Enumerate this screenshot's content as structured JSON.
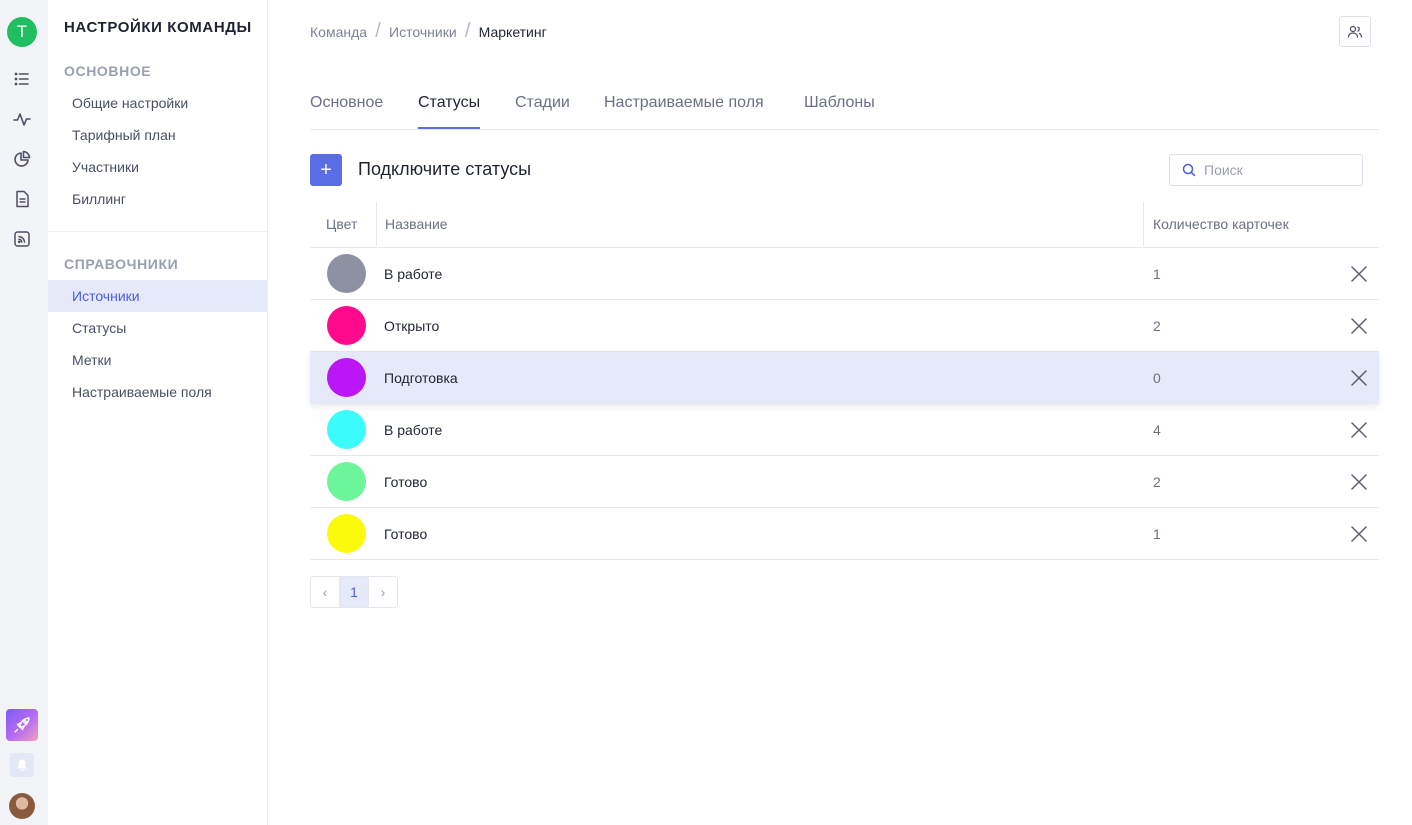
{
  "rail": {
    "team_initial": "T",
    "icons": [
      "list-icon",
      "activity-icon",
      "pie-chart-icon",
      "document-icon",
      "rss-icon"
    ],
    "bottom_icons": [
      "rocket-icon",
      "bell-icon",
      "user-avatar"
    ]
  },
  "sidebar": {
    "title": "НАСТРОЙКИ КОМАНДЫ",
    "sections": [
      {
        "label": "ОСНОВНОЕ",
        "items": [
          "Общие настройки",
          "Тарифный план",
          "Участники",
          "Биллинг"
        ]
      },
      {
        "label": "СПРАВОЧНИКИ",
        "items": [
          "Источники",
          "Статусы",
          "Метки",
          "Настраиваемые поля"
        ]
      }
    ],
    "active_item": "Источники"
  },
  "breadcrumb": [
    "Команда",
    "Источники",
    "Маркетинг"
  ],
  "tabs": {
    "items": [
      "Основное",
      "Статусы",
      "Стадии",
      "Настраиваемые поля",
      "Шаблоны"
    ],
    "active": "Статусы"
  },
  "header": {
    "add_label": "+",
    "title": "Подключите статусы"
  },
  "search": {
    "placeholder": "Поиск",
    "value": ""
  },
  "table": {
    "columns": [
      "Цвет",
      "Название",
      "Количество карточек"
    ],
    "rows": [
      {
        "color": "#8e91a2",
        "name": "В работе",
        "count": "1"
      },
      {
        "color": "#ff0a8c",
        "name": "Открыто",
        "count": "2"
      },
      {
        "color": "#bb16f5",
        "name": "Подготовка",
        "count": "0"
      },
      {
        "color": "#3cfbfb",
        "name": "В работе",
        "count": "4"
      },
      {
        "color": "#6cf59a",
        "name": "Готово",
        "count": "2"
      },
      {
        "color": "#fbf90c",
        "name": "Готово",
        "count": "1"
      }
    ],
    "highlighted_row": 2
  },
  "pagination": {
    "prev": "‹",
    "pages": [
      "1"
    ],
    "current": "1",
    "next": "›"
  },
  "colors": {
    "accent": "#5b6de5",
    "active_bg": "#e6e9fa",
    "team_avatar": "#1fbf5f"
  }
}
